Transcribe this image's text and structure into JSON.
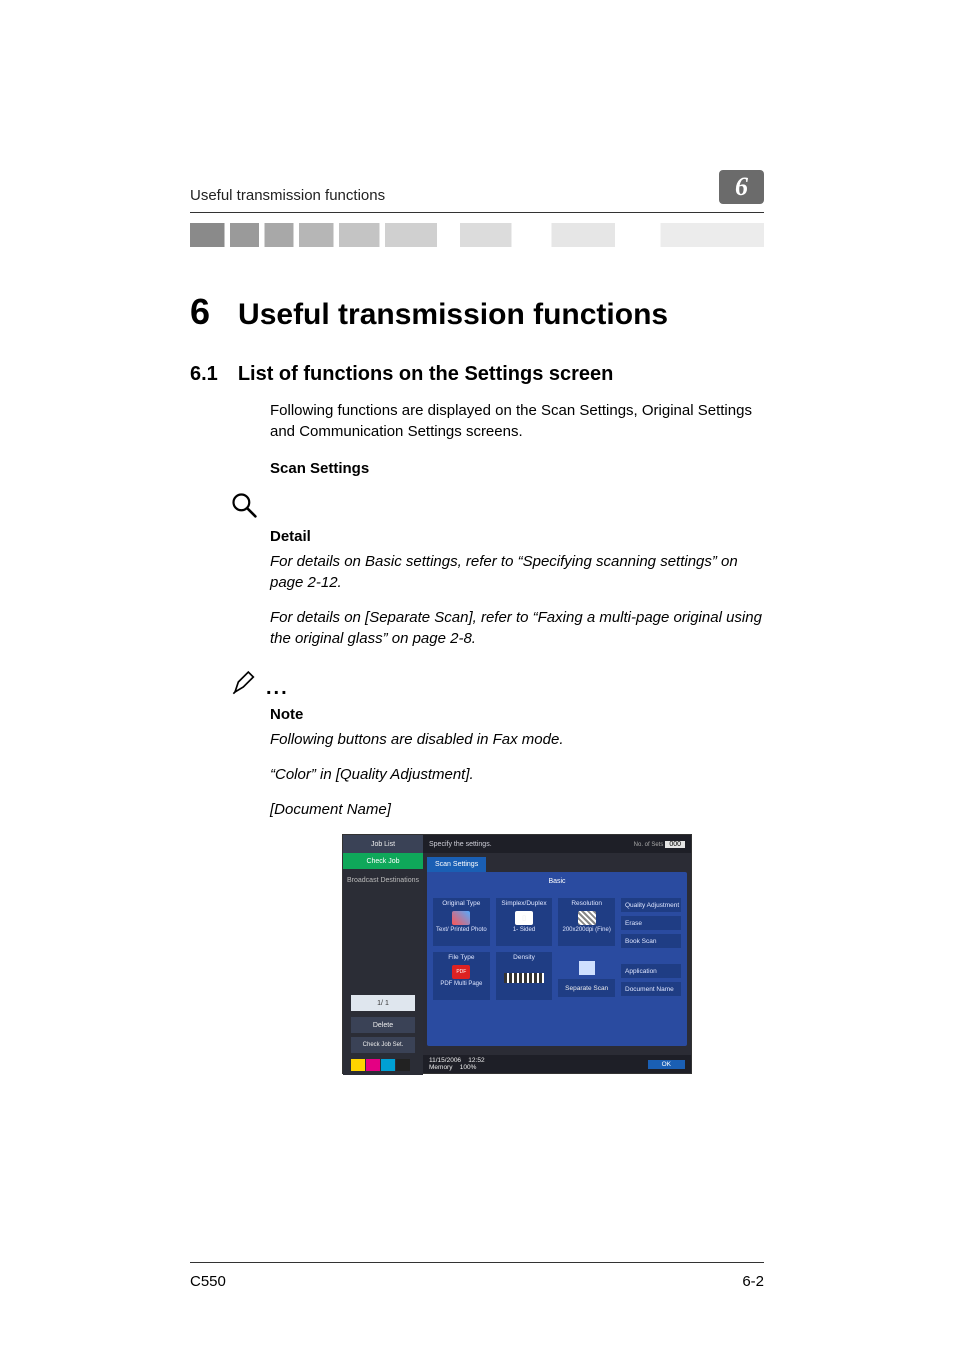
{
  "running_header": {
    "title": "Useful transmission functions",
    "badge": "6"
  },
  "chapter": {
    "number": "6",
    "title": "Useful transmission functions"
  },
  "section": {
    "number": "6.1",
    "title": "List of functions on the Settings screen"
  },
  "intro_para": "Following functions are displayed on the Scan Settings, Original Settings and Communication Settings screens.",
  "subhead": "Scan Settings",
  "detail": {
    "label": "Detail",
    "p1": "For details on Basic settings, refer to “Specifying scanning settings” on page 2-12.",
    "p2": "For details on [Separate Scan], refer to “Faxing a multi-page original using the original glass” on page 2-8."
  },
  "note": {
    "label": "Note",
    "p1": "Following buttons are disabled in Fax mode.",
    "p2": "“Color” in [Quality Adjustment].",
    "p3": "[Document Name]"
  },
  "screenshot": {
    "topbar_text": "Specify the settings.",
    "sets_label": "No. of Sets",
    "sets_value": "000",
    "tab_label": "Scan Settings",
    "basic_label": "Basic",
    "left": {
      "job_list": "Job List",
      "check_job": "Check Job",
      "broadcast": "Broadcast Destinations",
      "pager": "1/   1",
      "delete": "Delete",
      "check_job_set": "Check Job Set."
    },
    "boxes": {
      "original_type": "Original Type",
      "original_type_val": "Text/ Printed Photo",
      "simplex": "Simplex/Duplex",
      "simplex_val": "1- Sided",
      "resolution": "Resolution",
      "resolution_val": "200x200dpi (Fine)",
      "file_type": "File Type",
      "file_type_val": "PDF Multi Page",
      "density": "Density",
      "separate_scan": "Separate Scan"
    },
    "sidebtns": {
      "quality": "Quality Adjustment",
      "erase": "Erase",
      "book": "Book Scan",
      "application": "Application",
      "doc_name": "Document Name"
    },
    "bottom": {
      "date": "11/15/2006",
      "time": "12:52",
      "mem_label": "Memory",
      "mem_value": "100%",
      "ok": "OK"
    }
  },
  "footer": {
    "model": "C550",
    "page": "6-2"
  }
}
